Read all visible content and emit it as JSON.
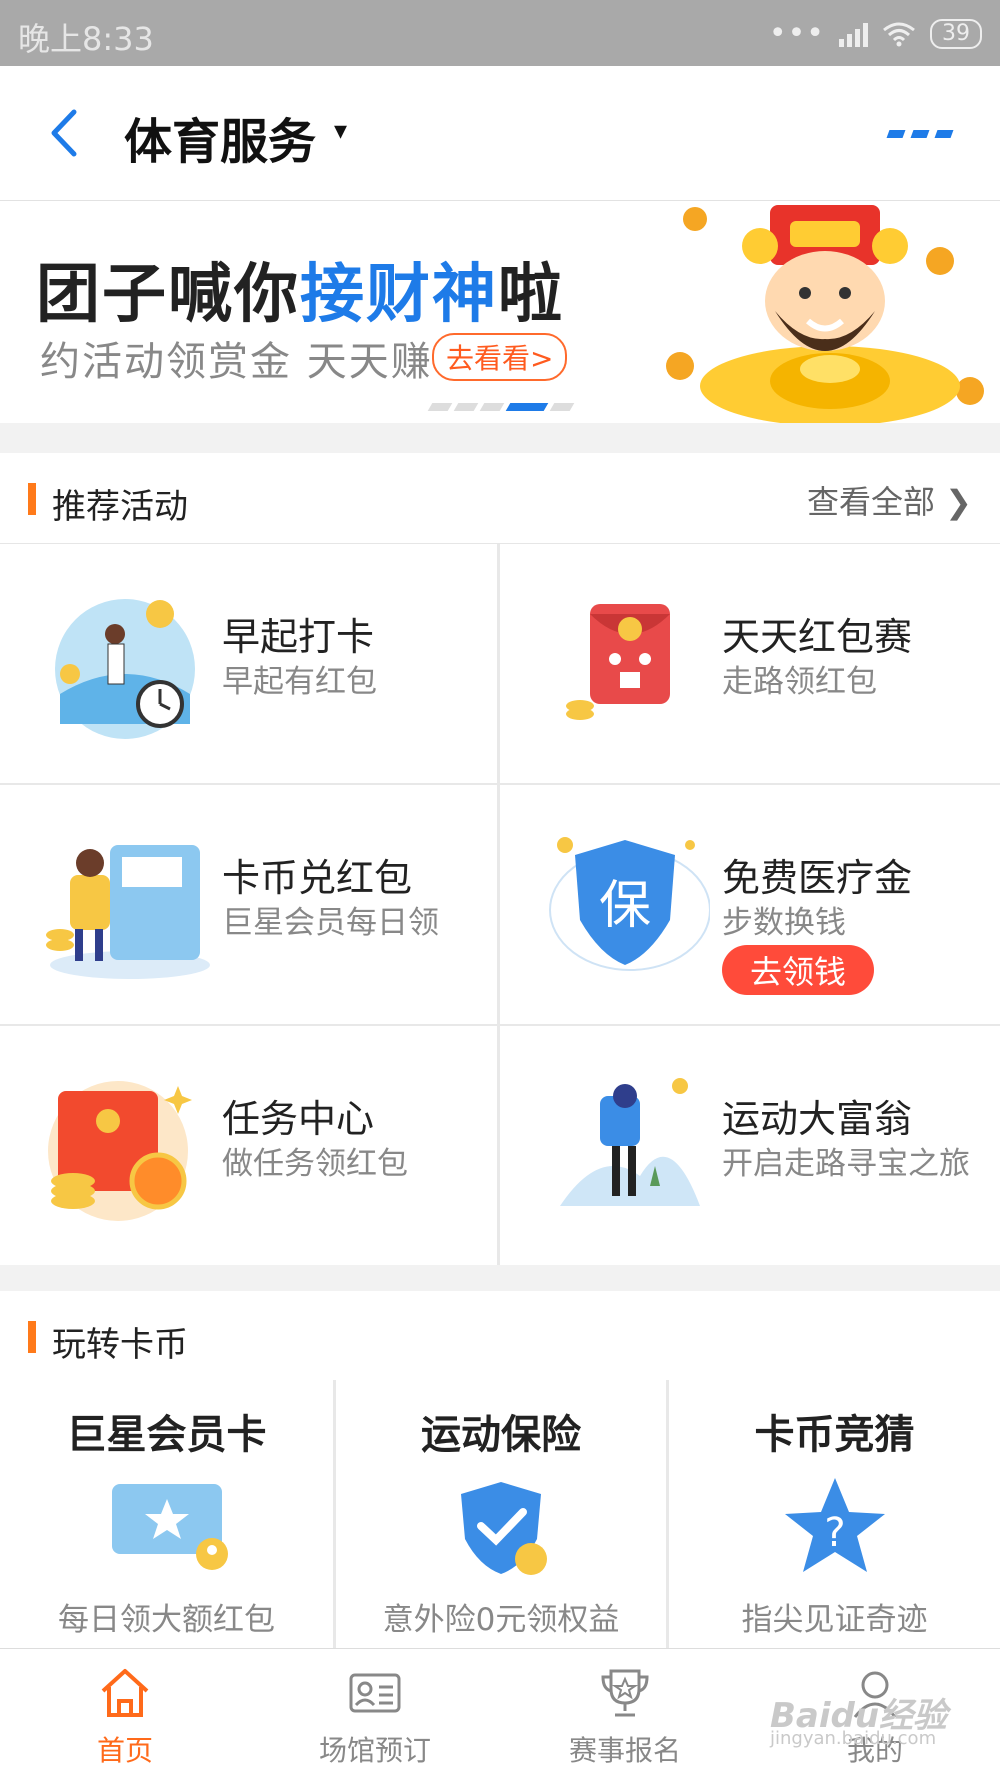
{
  "status_bar": {
    "time": "晚上8:33",
    "dots": "•••",
    "battery": "39"
  },
  "header": {
    "title": "体育服务",
    "caret": "▾"
  },
  "banner": {
    "headline_a": "团子喊你",
    "headline_b": "接财神",
    "headline_c": "啦",
    "subtitle": "约活动领赏金 天天赚",
    "button": "去看看>"
  },
  "recommended": {
    "title": "推荐活动",
    "view_all": "查看全部 ❯",
    "items": [
      {
        "name": "早起打卡",
        "desc": "早起有红包"
      },
      {
        "name": "天天红包赛",
        "desc": "走路领红包"
      },
      {
        "name": "卡币兑红包",
        "desc": "巨星会员每日领"
      },
      {
        "name": "免费医疗金",
        "desc": "步数换钱",
        "cta": "去领钱"
      },
      {
        "name": "任务中心",
        "desc": "做任务领红包"
      },
      {
        "name": "运动大富翁",
        "desc": "开启走路寻宝之旅"
      }
    ]
  },
  "coins": {
    "title": "玩转卡币",
    "cards": [
      {
        "title": "巨星会员卡",
        "desc": "每日领大额红包"
      },
      {
        "title": "运动保险",
        "desc": "意外险0元领权益"
      },
      {
        "title": "卡币竞猜",
        "desc": "指尖见证奇迹"
      }
    ]
  },
  "tabbar": {
    "tabs": [
      {
        "label": "首页"
      },
      {
        "label": "场馆预订"
      },
      {
        "label": "赛事报名"
      },
      {
        "label": "我的"
      }
    ]
  },
  "watermark": {
    "brand": "Baidu经验",
    "url": "jingyan.baidu.com"
  },
  "colors": {
    "accent_blue": "#1e7be8",
    "accent_orange": "#ff6a1a",
    "cta_red": "#ff4b3a"
  }
}
